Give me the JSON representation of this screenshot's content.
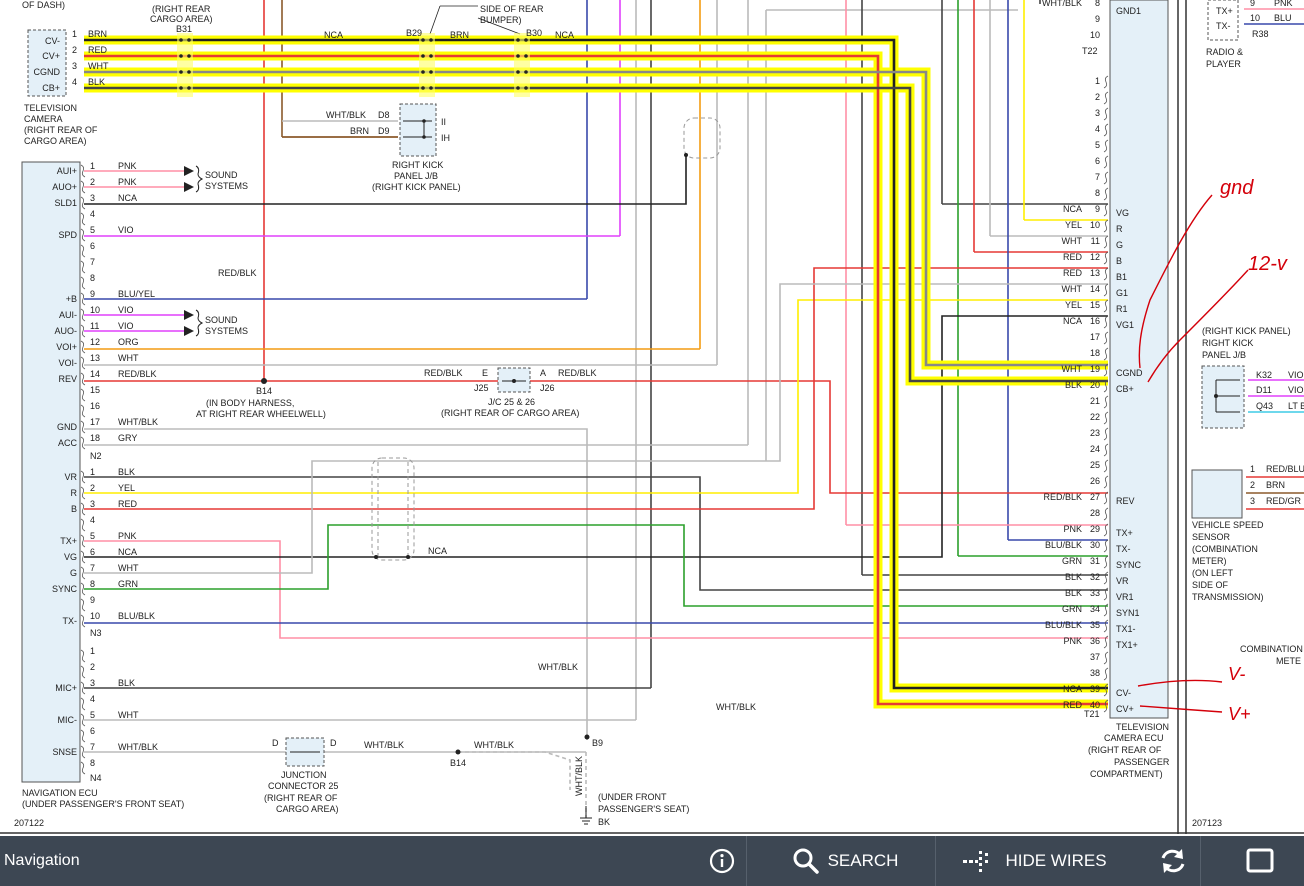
{
  "toolbar": {
    "title": "Navigation",
    "search_label": "SEARCH",
    "hide_wires_label": "HIDE WIRES"
  },
  "diagram": {
    "left_page_id": "207122",
    "right_page_id": "207123",
    "header_fragments": [
      "OF DASH)",
      "(RIGHT REAR",
      "CARGO AREA)",
      "SIDE OF REAR",
      "BUMPER)"
    ],
    "tv_camera": {
      "pins": [
        "CV-",
        "CV+",
        "CGND",
        "CB+"
      ],
      "pin_nums": [
        "1",
        "2",
        "3",
        "4"
      ],
      "wires": [
        "BRN",
        "RED",
        "WHT",
        "BLK"
      ],
      "label": [
        "TELEVISION",
        "CAMERA",
        "(RIGHT REAR OF",
        "CARGO AREA)"
      ]
    },
    "connectors": {
      "b31": "B31",
      "b29": "B29",
      "b30": "B30",
      "nca_b31": "NCA",
      "brn_b29": "BRN",
      "nca_b30": "NCA",
      "b14": "B14",
      "b9": "B9",
      "bk": "BK",
      "n2": "N2",
      "n3": "N3",
      "n4": "N4",
      "t21": "T21",
      "t22": "T22"
    },
    "kick_jb": {
      "wires": [
        "WHT/BLK",
        "BRN"
      ],
      "pins": [
        "D8",
        "D9"
      ],
      "ends": [
        "II",
        "IH"
      ],
      "label": [
        "RIGHT KICK",
        "PANEL J/B",
        "(RIGHT KICK PANEL)"
      ]
    },
    "nav_ecu": {
      "n1": [
        {
          "pin": "AUI+",
          "num": "1",
          "wire": "PNK"
        },
        {
          "pin": "AUO+",
          "num": "2",
          "wire": "PNK"
        },
        {
          "pin": "SLD1",
          "num": "3",
          "wire": "NCA"
        },
        {
          "pin": "",
          "num": "4",
          "wire": ""
        },
        {
          "pin": "SPD",
          "num": "5",
          "wire": "VIO"
        },
        {
          "pin": "",
          "num": "6",
          "wire": ""
        },
        {
          "pin": "",
          "num": "7",
          "wire": ""
        },
        {
          "pin": "",
          "num": "8",
          "wire": ""
        },
        {
          "pin": "+B",
          "num": "9",
          "wire": "BLU/YEL"
        },
        {
          "pin": "AUI-",
          "num": "10",
          "wire": "VIO"
        },
        {
          "pin": "AUO-",
          "num": "11",
          "wire": "VIO"
        },
        {
          "pin": "VOI+",
          "num": "12",
          "wire": "ORG"
        },
        {
          "pin": "VOI-",
          "num": "13",
          "wire": "WHT"
        },
        {
          "pin": "REV",
          "num": "14",
          "wire": "RED/BLK"
        },
        {
          "pin": "",
          "num": "15",
          "wire": ""
        },
        {
          "pin": "",
          "num": "16",
          "wire": ""
        },
        {
          "pin": "GND",
          "num": "17",
          "wire": "WHT/BLK"
        },
        {
          "pin": "ACC",
          "num": "18",
          "wire": "GRY"
        }
      ],
      "n3": [
        {
          "pin": "VR",
          "num": "1",
          "wire": "BLK"
        },
        {
          "pin": "R",
          "num": "2",
          "wire": "YEL"
        },
        {
          "pin": "B",
          "num": "3",
          "wire": "RED"
        },
        {
          "pin": "",
          "num": "4",
          "wire": ""
        },
        {
          "pin": "TX+",
          "num": "5",
          "wire": "PNK"
        },
        {
          "pin": "VG",
          "num": "6",
          "wire": "NCA"
        },
        {
          "pin": "G",
          "num": "7",
          "wire": "WHT"
        },
        {
          "pin": "SYNC",
          "num": "8",
          "wire": "GRN"
        },
        {
          "pin": "",
          "num": "9",
          "wire": ""
        },
        {
          "pin": "TX-",
          "num": "10",
          "wire": "BLU/BLK"
        }
      ],
      "n4": [
        {
          "pin": "",
          "num": "1",
          "wire": ""
        },
        {
          "pin": "",
          "num": "2",
          "wire": ""
        },
        {
          "pin": "MIC+",
          "num": "3",
          "wire": "BLK"
        },
        {
          "pin": "",
          "num": "4",
          "wire": ""
        },
        {
          "pin": "MIC-",
          "num": "5",
          "wire": "WHT"
        },
        {
          "pin": "",
          "num": "6",
          "wire": ""
        },
        {
          "pin": "SNSE",
          "num": "7",
          "wire": "WHT/BLK"
        },
        {
          "pin": "",
          "num": "8",
          "wire": ""
        }
      ],
      "label": [
        "NAVIGATION ECU",
        "(UNDER PASSENGER'S FRONT SEAT)"
      ]
    },
    "sound_systems": [
      "SOUND",
      "SYSTEMS"
    ],
    "red_blk_label": "RED/BLK",
    "body_harness": [
      "B14",
      "(IN BODY HARNESS,",
      "AT RIGHT REAR WHEELWELL)"
    ],
    "jc": {
      "left_wire": "RED/BLK",
      "right_wire": "RED/BLK",
      "e": "E",
      "a": "A",
      "j25": "J25",
      "j26": "J26",
      "label": [
        "J/C 25 & 26",
        "(RIGHT REAR OF CARGO AREA)"
      ]
    },
    "nca_mid": "NCA",
    "wht_blk_labels": [
      "WHT/BLK",
      "WHT/BLK",
      "WHT/BLK",
      "WHT/BLK",
      "WHT/BLK"
    ],
    "junction25": {
      "d_left": "D",
      "d_right": "D",
      "label": [
        "JUNCTION",
        "CONNECTOR 25",
        "(RIGHT REAR OF",
        "CARGO AREA)"
      ]
    },
    "ground_label": [
      "(UNDER FRONT",
      "PASSENGER'S SEAT)"
    ],
    "tv_ecu": {
      "t22": [
        {
          "num": "8",
          "wire": "WHT/BLK",
          "pin": "GND1"
        },
        {
          "num": "9",
          "wire": "",
          "pin": ""
        },
        {
          "num": "10",
          "wire": "",
          "pin": ""
        }
      ],
      "t21": [
        {
          "num": "1",
          "wire": "",
          "pin": ""
        },
        {
          "num": "2",
          "wire": "",
          "pin": ""
        },
        {
          "num": "3",
          "wire": "",
          "pin": ""
        },
        {
          "num": "4",
          "wire": "",
          "pin": ""
        },
        {
          "num": "5",
          "wire": "",
          "pin": ""
        },
        {
          "num": "6",
          "wire": "",
          "pin": ""
        },
        {
          "num": "7",
          "wire": "",
          "pin": ""
        },
        {
          "num": "8",
          "wire": "",
          "pin": ""
        },
        {
          "num": "9",
          "wire": "NCA",
          "pin": "VG"
        },
        {
          "num": "10",
          "wire": "YEL",
          "pin": "R"
        },
        {
          "num": "11",
          "wire": "WHT",
          "pin": "G"
        },
        {
          "num": "12",
          "wire": "RED",
          "pin": "B"
        },
        {
          "num": "13",
          "wire": "RED",
          "pin": "B1"
        },
        {
          "num": "14",
          "wire": "WHT",
          "pin": "G1"
        },
        {
          "num": "15",
          "wire": "YEL",
          "pin": "R1"
        },
        {
          "num": "16",
          "wire": "NCA",
          "pin": "VG1"
        },
        {
          "num": "17",
          "wire": "",
          "pin": ""
        },
        {
          "num": "18",
          "wire": "",
          "pin": ""
        },
        {
          "num": "19",
          "wire": "WHT",
          "pin": "CGND"
        },
        {
          "num": "20",
          "wire": "BLK",
          "pin": "CB+"
        },
        {
          "num": "21",
          "wire": "",
          "pin": ""
        },
        {
          "num": "22",
          "wire": "",
          "pin": ""
        },
        {
          "num": "23",
          "wire": "",
          "pin": ""
        },
        {
          "num": "24",
          "wire": "",
          "pin": ""
        },
        {
          "num": "25",
          "wire": "",
          "pin": ""
        },
        {
          "num": "26",
          "wire": "",
          "pin": ""
        },
        {
          "num": "27",
          "wire": "RED/BLK",
          "pin": "REV"
        },
        {
          "num": "28",
          "wire": "",
          "pin": ""
        },
        {
          "num": "29",
          "wire": "PNK",
          "pin": "TX+"
        },
        {
          "num": "30",
          "wire": "BLU/BLK",
          "pin": "TX-"
        },
        {
          "num": "31",
          "wire": "GRN",
          "pin": "SYNC"
        },
        {
          "num": "32",
          "wire": "BLK",
          "pin": "VR"
        },
        {
          "num": "33",
          "wire": "BLK",
          "pin": "VR1"
        },
        {
          "num": "34",
          "wire": "GRN",
          "pin": "SYN1"
        },
        {
          "num": "35",
          "wire": "BLU/BLK",
          "pin": "TX1-"
        },
        {
          "num": "36",
          "wire": "PNK",
          "pin": "TX1+"
        },
        {
          "num": "37",
          "wire": "",
          "pin": ""
        },
        {
          "num": "38",
          "wire": "",
          "pin": ""
        },
        {
          "num": "39",
          "wire": "NCA",
          "pin": "CV-"
        },
        {
          "num": "40",
          "wire": "RED",
          "pin": "CV+"
        }
      ],
      "label": [
        "TELEVISION",
        "CAMERA ECU",
        "(RIGHT REAR OF",
        "PASSENGER",
        "COMPARTMENT)"
      ]
    },
    "right_page": {
      "radio_pins": [
        "TX+",
        "TX-"
      ],
      "radio_nums": [
        "9",
        "10"
      ],
      "radio_wires": [
        "PNK",
        "BLU"
      ],
      "r38": "R38",
      "radio_label": [
        "RADIO &",
        "PLAYER"
      ],
      "kick_label": [
        "(RIGHT KICK PANEL)",
        "RIGHT KICK",
        "PANEL J/B"
      ],
      "kick_pins": [
        "K32",
        "D11",
        "Q43"
      ],
      "kick_wires": [
        "VIO",
        "VIO",
        "LT B"
      ],
      "vss_nums": [
        "1",
        "2",
        "3"
      ],
      "vss_wires": [
        "RED/BLU",
        "BRN",
        "RED/GR"
      ],
      "vss_label": [
        "VEHICLE SPEED",
        "SENSOR",
        "(COMBINATION",
        "METER)",
        "(ON LEFT",
        "SIDE OF",
        "TRANSMISSION)"
      ],
      "combo_label": [
        "COMBINATION",
        "METE"
      ]
    },
    "handwriting": {
      "gnd": "gnd",
      "twelve_v": "12-v",
      "v_minus": "V-",
      "v_plus": "V+"
    },
    "colors": {
      "highlight": "#ffff00",
      "wire_red": "#e53935",
      "wire_black": "#222222",
      "wire_pink": "#ff8fa6",
      "wire_violet": "#e040fb",
      "wire_orange": "#f39c12",
      "wire_blue": "#3949ab",
      "wire_green": "#2ca02c",
      "wire_gray": "#bbbbbb",
      "wire_brown": "#8b5a2b",
      "ink": "#d4000a",
      "connector_fill": "#e4f0f8",
      "toolbar_bg": "#3d4753"
    }
  }
}
